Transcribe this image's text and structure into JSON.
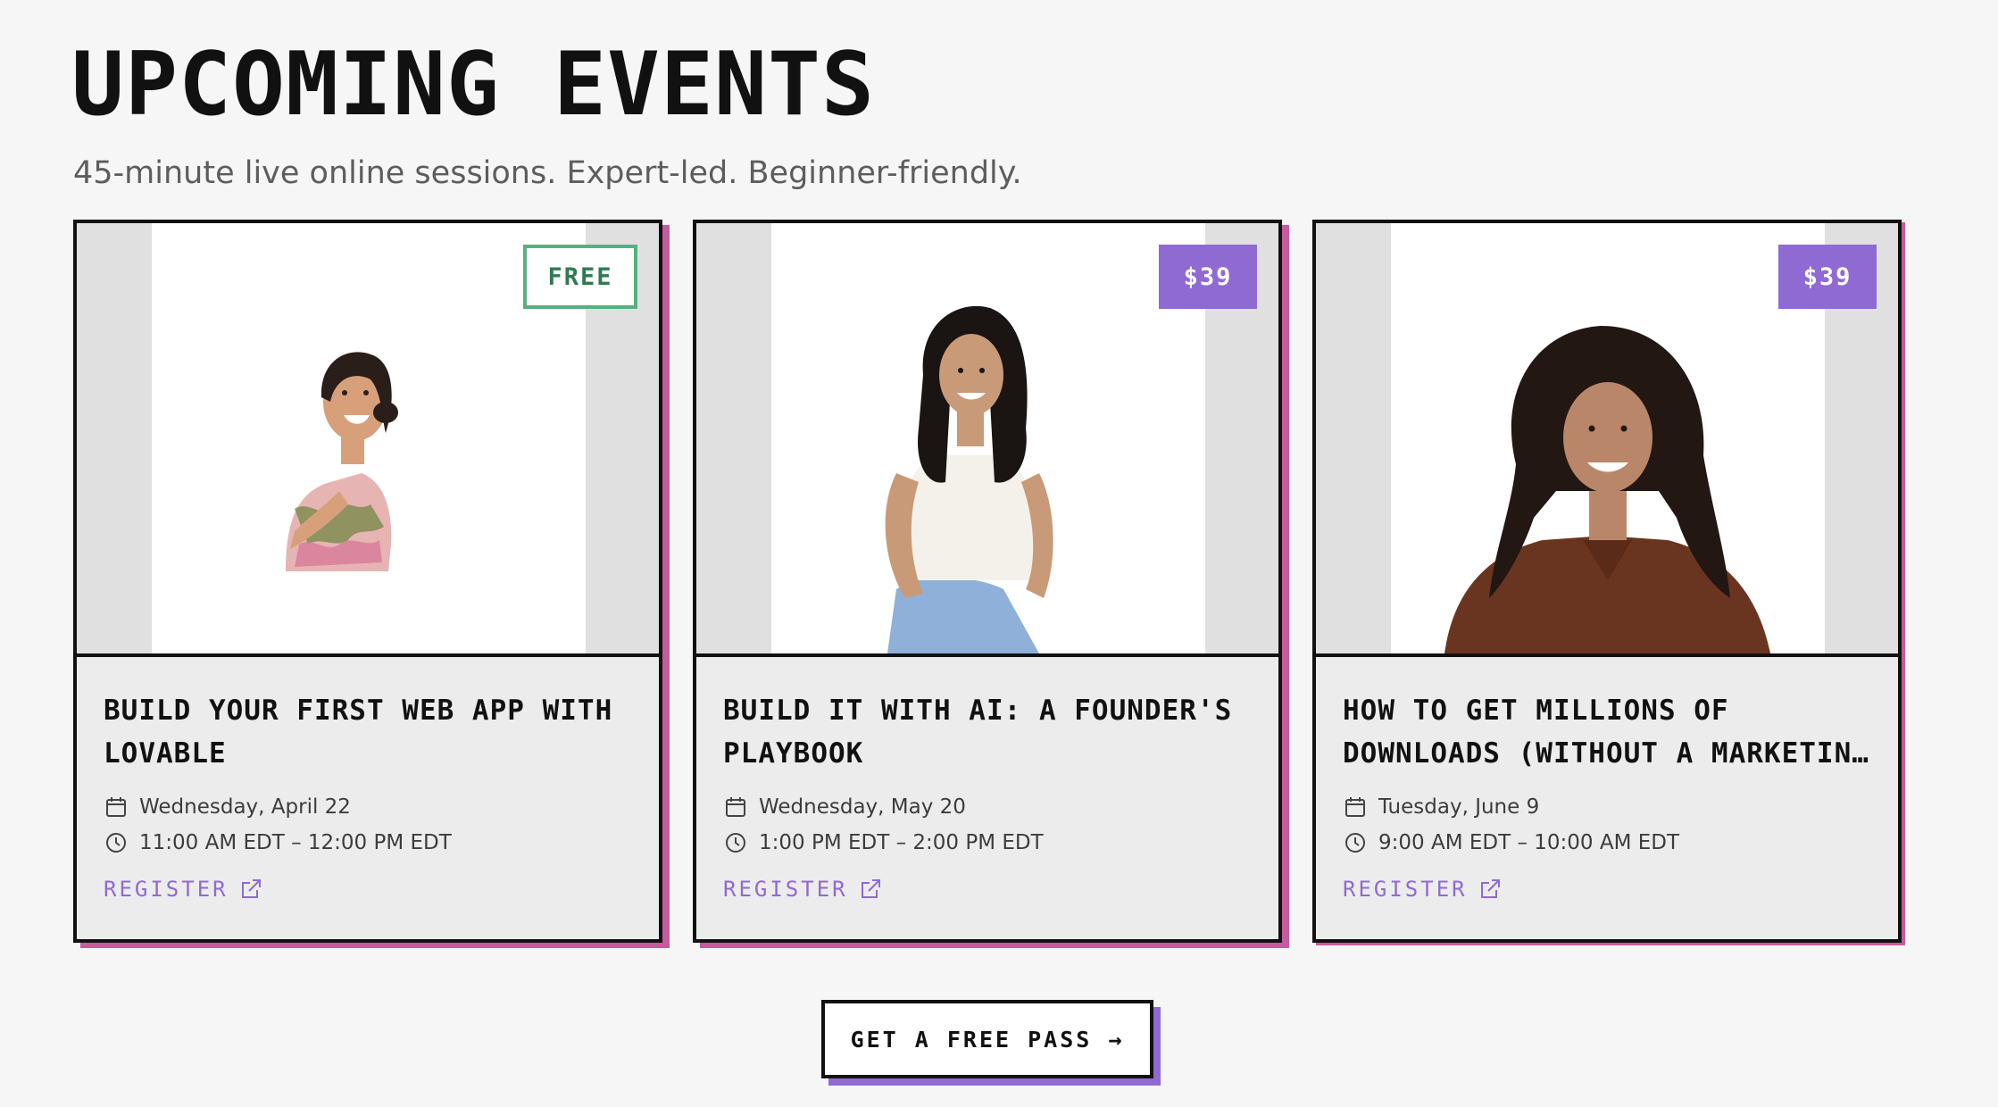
{
  "header": {
    "title": "UPCOMING EVENTS",
    "subtitle": "45-minute live online sessions. Expert-led. Beginner-friendly."
  },
  "events": [
    {
      "badge": "FREE",
      "badge_type": "free",
      "title": "BUILD YOUR FIRST WEB APP WITH LOVABLE",
      "date": "Wednesday, April 22",
      "time": "11:00 AM EDT – 12:00 PM EDT",
      "register_label": "REGISTER",
      "photo_icon": "speaker-photo"
    },
    {
      "badge": "$39",
      "badge_type": "paid",
      "title": "BUILD IT WITH AI: A FOUNDER'S PLAYBOOK",
      "date": "Wednesday, May 20",
      "time": "1:00 PM EDT – 2:00 PM EDT",
      "register_label": "REGISTER",
      "photo_icon": "speaker-photo"
    },
    {
      "badge": "$39",
      "badge_type": "paid",
      "title": "HOW TO GET MILLIONS OF DOWNLOADS (WITHOUT A MARKETIN…",
      "date": "Tuesday, June 9",
      "time": "9:00 AM EDT – 10:00 AM EDT",
      "register_label": "REGISTER",
      "photo_icon": "speaker-photo"
    }
  ],
  "cta": {
    "label": "GET A FREE PASS →"
  },
  "icons": {
    "date": "calendar-icon",
    "time": "clock-icon",
    "register": "external-link-icon"
  },
  "colors": {
    "background": "#f6f6f6",
    "card_background": "#ececec",
    "accent_purple": "#8f6ad3",
    "accent_pink": "#c95a9d",
    "free_green": "#57b080",
    "text_dark": "#111111"
  }
}
